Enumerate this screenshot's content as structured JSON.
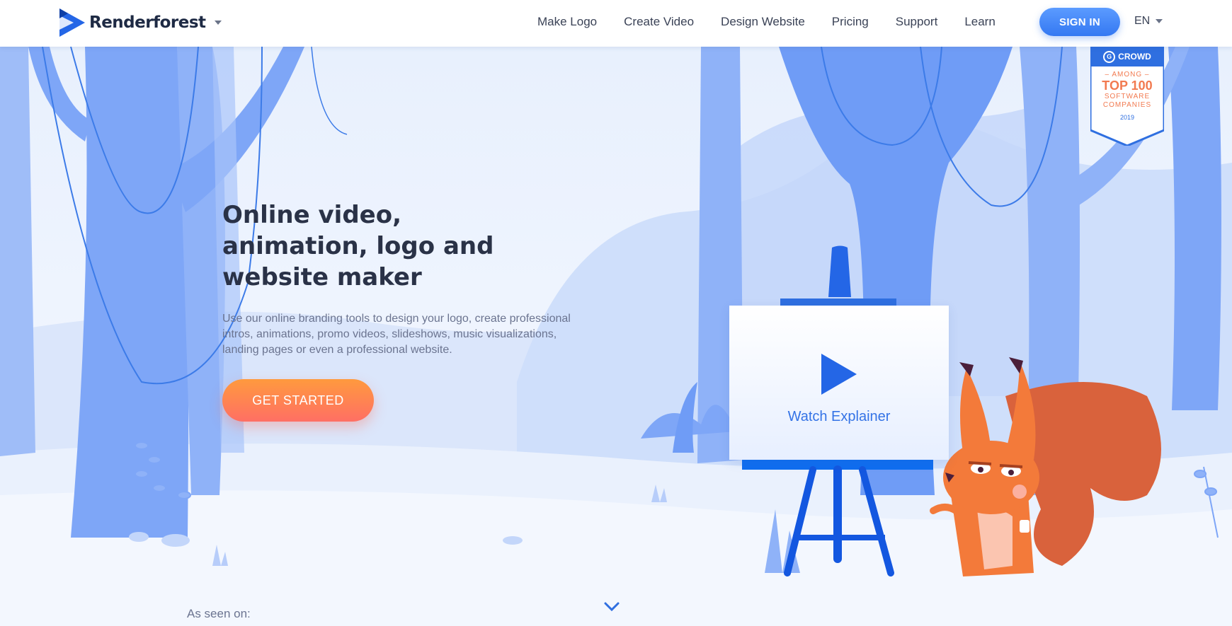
{
  "header": {
    "brand": "Renderforest",
    "nav": [
      "Make Logo",
      "Create Video",
      "Design Website",
      "Pricing",
      "Support",
      "Learn"
    ],
    "signin_label": "SIGN IN",
    "language": "EN"
  },
  "badge": {
    "brand": "CROWD",
    "logo_letter": "G",
    "line1": "– AMONG –",
    "line2": "TOP 100",
    "line3": "SOFTWARE",
    "line4": "COMPANIES",
    "year": "2019"
  },
  "hero": {
    "title_lines": [
      "Online video,",
      "animation, logo and",
      "website maker"
    ],
    "subtitle_lines": [
      "Use our online branding tools to design your logo, create professional",
      "intros, animations, promo videos, slideshows, music visualizations,",
      "landing pages or even a professional website."
    ],
    "cta_label": "GET STARTED",
    "watch_label": "Watch Explainer"
  },
  "footer_strip": {
    "as_seen_label": "As seen on:"
  },
  "colors": {
    "accent_blue": "#3478f2",
    "cta_orange": "#ff8a4c",
    "title_dark": "#2a3247",
    "tree_blue": "#7ea6f7",
    "squirrel": "#f37a3a"
  }
}
